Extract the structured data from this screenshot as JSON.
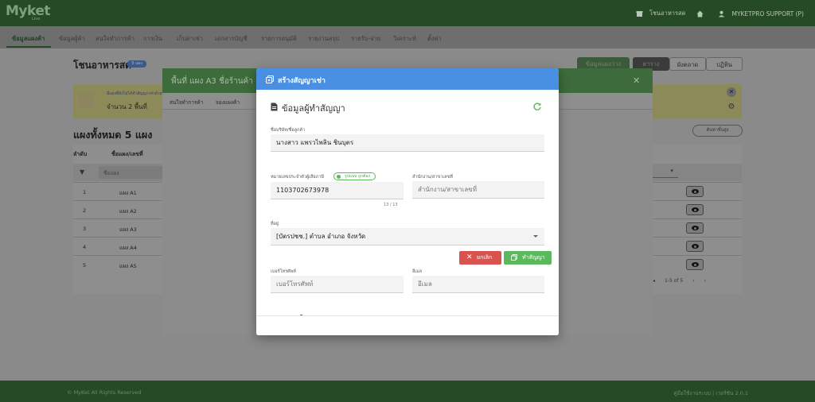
{
  "app": {
    "logo": "Myket",
    "logo_sub": "Live"
  },
  "topbar": {
    "store_name": "โชนอาหารสด",
    "user": "MYKETPRO SUPPORT (P)"
  },
  "nav": {
    "items": [
      "ข้อมูลแผงค้า",
      "ข้อมูลผู้ค้า",
      "สนใจทำการค้า",
      "การเงิน",
      "เก็บค่าเช่า",
      "เอกสารบัญชี",
      "รายการอนุมัติ",
      "รายงานสรุป",
      "รายรับ-จ่าย",
      "วิเคราะห์",
      "ตั้งค่า"
    ]
  },
  "page": {
    "title": "โชนอาหารสด",
    "badge": "5 แผง",
    "buttons": [
      "ข้อมูลแผงว่าง",
      "ตาราง",
      "ผังตลาด",
      "ปฏิทิน"
    ],
    "info_line1": "มีแผงที่ยังไม่ได้ทำสัญญาเช่าด้วยนะ",
    "info_line2": "จำนวน 2 พื้นที่",
    "section_title": "แผงทั้งหมด 5 แผง",
    "pill_button": "ค้นหาขั้นสูง",
    "table_headers": [
      "ลำดับ",
      "ชื่อแผง/เลขที่"
    ],
    "filter_placeholder": "ชื่อแผง",
    "rows": [
      {
        "num": "1",
        "name": "แผง A1"
      },
      {
        "num": "2",
        "name": "แผง A2"
      },
      {
        "num": "3",
        "name": "แผง A3"
      },
      {
        "num": "4",
        "name": "แผง A4"
      },
      {
        "num": "5",
        "name": "แผง A5"
      }
    ],
    "pagination": "1-5 of 5"
  },
  "footer": {
    "left": "© MyKet All Rights Reserved",
    "right": "คู่มือใช้งานระบบ | เวอร์ชัน 2.0.1"
  },
  "dialog_back": {
    "title": "พื้นที่ แผง A3  ชื่อร้านค้า",
    "tabs": [
      "สนใจทำการค้า",
      "จองแผงค้า"
    ]
  },
  "modal": {
    "header_title": "สร้างสัญญาเช่า",
    "section_title": "ข้อมูลผู้ทำสัญญา",
    "fields": {
      "company_label": "ชื่อบริษัท/ชื่อลูกค้า",
      "company_value": "นางสาว แพรวไพลิน ชินบุตร",
      "taxid_label": "หมายเลขประจำตัวผู้เสียภาษี",
      "taxid_verified": "รูปแบบ ถูกต้อง",
      "taxid_value": "1103702673978",
      "taxid_counter": "13 / 13",
      "branch_label": "สำนักงาน/สาขาเลขที่",
      "branch_placeholder": "สำนักงาน/สาขาเลขที่",
      "address_label": "ที่อยู่",
      "address_value": "[บัตรปชช.]  ตำบล อำเภอ จังหวัด",
      "phone_label": "เบอร์โทรศัพท์",
      "phone_placeholder": "เบอร์โทรศัพท์",
      "email_label": "อีเมล",
      "email_placeholder": "อีเมล"
    },
    "cancel_label": "ยกเลิก",
    "confirm_label": "ทำสัญญา"
  },
  "colors": {
    "header_blue": "#4a90e2",
    "confirm_green": "#5cb85c",
    "cancel_red": "#d9534f",
    "brand_green": "#264a25"
  }
}
